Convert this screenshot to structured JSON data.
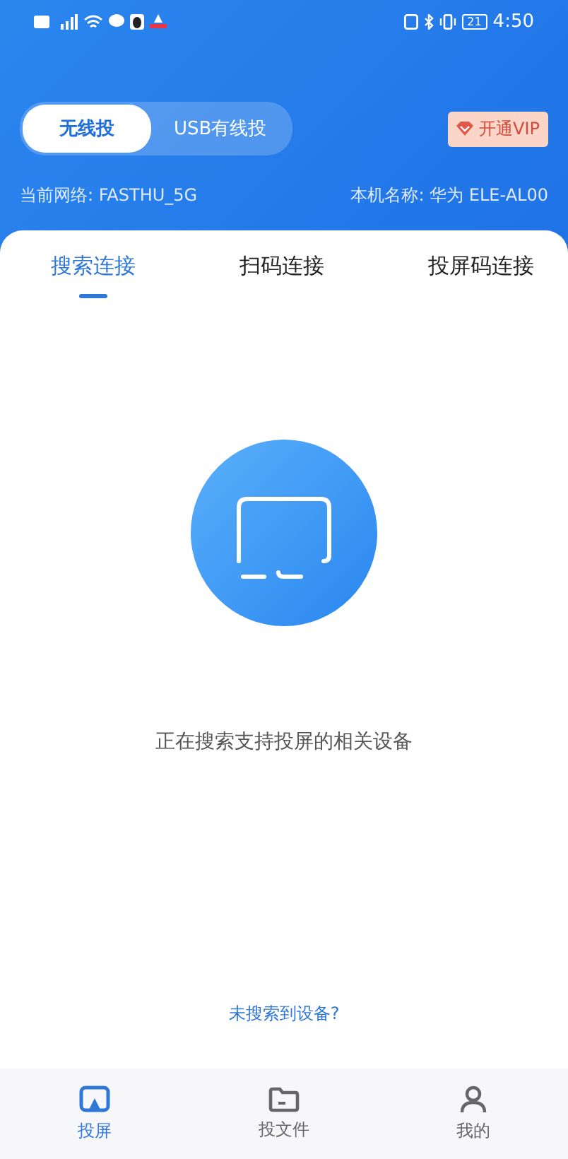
{
  "status_bar": {
    "battery": "21",
    "time": "4:50"
  },
  "mode_switch": [
    {
      "label": "无线投",
      "selected": true
    },
    {
      "label": "USB有线投",
      "selected": false
    }
  ],
  "vip_button": {
    "label": "开通VIP"
  },
  "network": "当前网络: FASTHU_5G",
  "device_name": "本机名称: 华为 ELE-AL00",
  "tabs": [
    {
      "label": "搜索连接",
      "selected": true
    },
    {
      "label": "扫码连接",
      "selected": false
    },
    {
      "label": "投屏码连接",
      "selected": false
    }
  ],
  "status_text": "正在搜索支持投屏的相关设备",
  "help_link": "未搜索到设备?",
  "bottom_nav": [
    {
      "label": "投屏",
      "kind": "cast",
      "selected": true
    },
    {
      "label": "投文件",
      "kind": "folder",
      "selected": false
    },
    {
      "label": "我的",
      "kind": "person",
      "selected": false
    }
  ]
}
